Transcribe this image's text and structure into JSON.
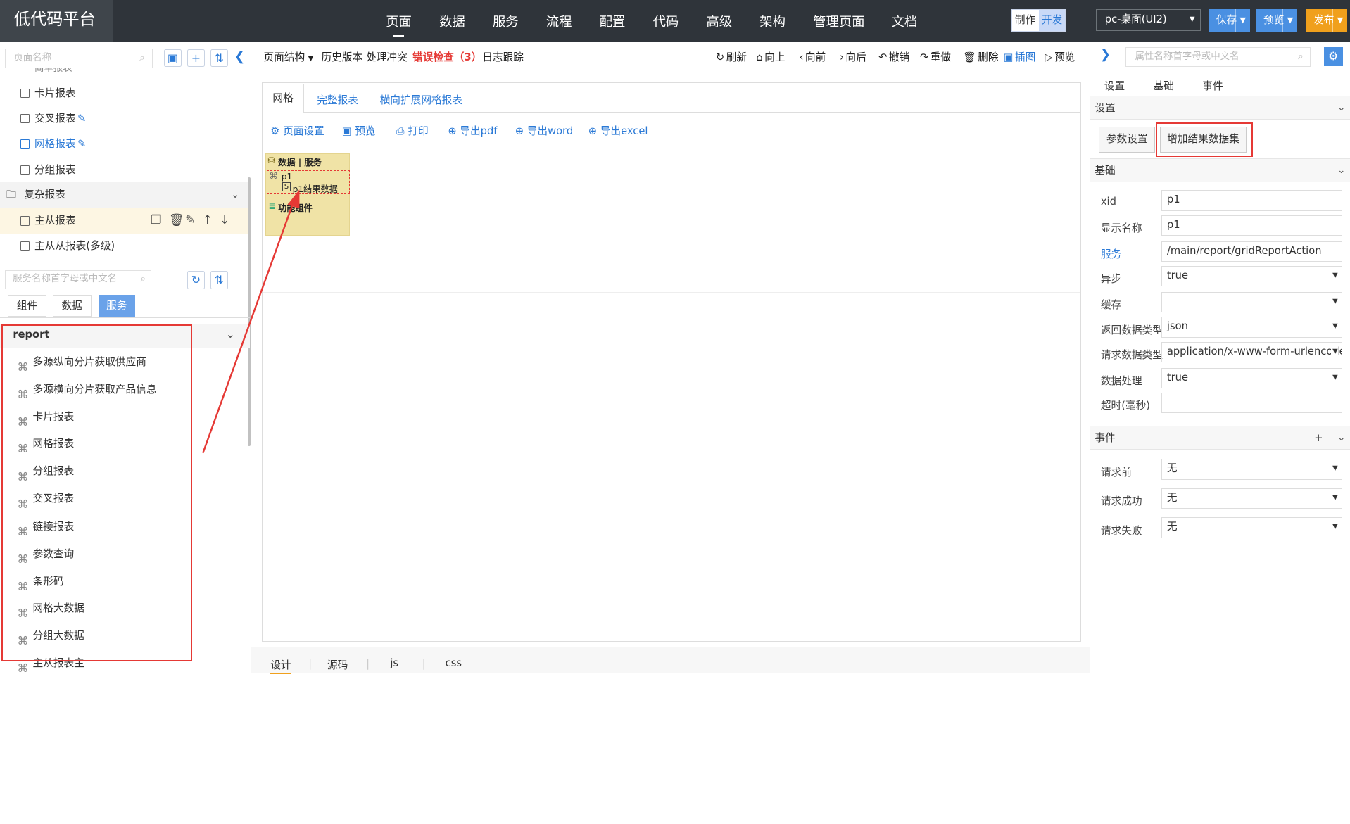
{
  "app": {
    "logo": "低代码平台"
  },
  "topnav": [
    "页面",
    "数据",
    "服务",
    "流程",
    "配置",
    "代码",
    "高级",
    "架构",
    "管理页面",
    "文档"
  ],
  "mode": {
    "make": "制作",
    "dev": "开发"
  },
  "device": "pc-桌面(UI2)",
  "buttons": {
    "save": "保存",
    "preview": "预览",
    "publish": "发布"
  },
  "left": {
    "search_placeholder": "页面名称",
    "cut_item": "简单报表",
    "tree": [
      "卡片报表",
      "交叉报表",
      "网格报表",
      "分组报表"
    ],
    "group": "复杂报表",
    "group_items": [
      "主从报表",
      "主从从报表(多级)"
    ],
    "service_search_placeholder": "服务名称首字母或中文名",
    "tabs": [
      "组件",
      "数据",
      "服务"
    ],
    "service_group": "report",
    "services": [
      "多源纵向分片获取供应商",
      "多源横向分片获取产品信息",
      "卡片报表",
      "网格报表",
      "分组报表",
      "交叉报表",
      "链接报表",
      "参数查询",
      "条形码",
      "网格大数据",
      "分组大数据",
      "主从报表主"
    ]
  },
  "toolbar": {
    "structure": "页面结构",
    "history": "历史版本",
    "conflict": "处理冲突",
    "errors": "错误检查（3）",
    "log": "日志跟踪",
    "refresh": "刷新",
    "up": "向上",
    "forward": "向前",
    "back": "向后",
    "undo": "撤销",
    "redo": "重做",
    "delete": "删除",
    "insert": "插图",
    "preview": "预览"
  },
  "canvas": {
    "tabs": [
      "网格",
      "完整报表",
      "横向扩展网格报表"
    ],
    "actions": [
      "页面设置",
      "预览",
      "打印",
      "导出pdf",
      "导出word",
      "导出excel"
    ],
    "data_box": {
      "title": "数据 | 服务",
      "service": "p1",
      "result": "p1结果数据",
      "func": "功能组件"
    }
  },
  "bottom_tabs": [
    "设计",
    "源码",
    "js",
    "css"
  ],
  "right": {
    "search_placeholder": "属性名称首字母或中文名",
    "tabs": [
      "设置",
      "基础",
      "事件"
    ],
    "settings_section": "设置",
    "param_btn": "参数设置",
    "add_result_btn": "增加结果数据集",
    "basic_section": "基础",
    "fields": [
      {
        "label": "xid",
        "value": "p1"
      },
      {
        "label": "显示名称",
        "value": "p1"
      },
      {
        "label": "服务",
        "value": "/main/report/gridReportAction"
      },
      {
        "label": "异步",
        "value": "true"
      },
      {
        "label": "缓存",
        "value": ""
      },
      {
        "label": "返回数据类型",
        "value": "json"
      },
      {
        "label": "请求数据类型",
        "value": "application/x-www-form-urlencoded"
      },
      {
        "label": "数据处理",
        "value": "true"
      },
      {
        "label": "超时(毫秒)",
        "value": ""
      }
    ],
    "event_section": "事件",
    "event_add": "+",
    "events": [
      {
        "label": "请求前",
        "value": "无"
      },
      {
        "label": "请求成功",
        "value": "无"
      },
      {
        "label": "请求失败",
        "value": "无"
      }
    ]
  },
  "colors": {
    "topbar": "#2f343a",
    "accent": "#2a79d6",
    "highlight": "#e53935",
    "save": "#4a90e2",
    "publish": "#f0a01c"
  }
}
